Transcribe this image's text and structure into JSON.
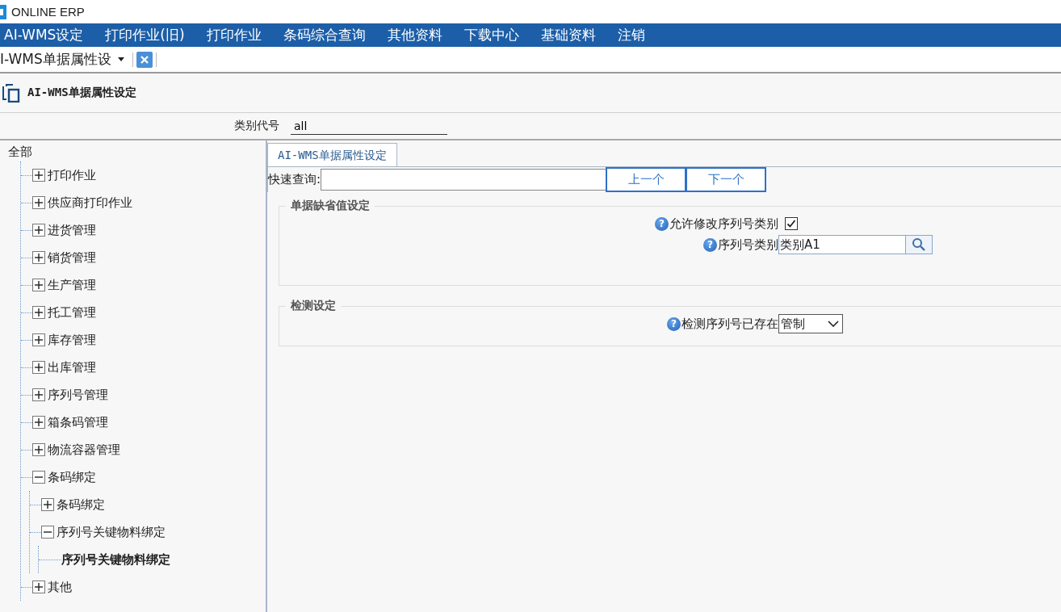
{
  "window": {
    "title": "ONLINE ERP"
  },
  "menu": [
    {
      "label": "AI-WMS设定"
    },
    {
      "label": "打印作业(旧)"
    },
    {
      "label": "打印作业"
    },
    {
      "label": "条码综合查询"
    },
    {
      "label": "其他资料"
    },
    {
      "label": "下载中心"
    },
    {
      "label": "基础资料"
    },
    {
      "label": "注销"
    }
  ],
  "doc_tabs": [
    {
      "label": "I-WMS单据属性设",
      "selected": true
    }
  ],
  "page": {
    "title": "AI-WMS单据属性设定"
  },
  "filter": {
    "label": "类别代号",
    "value": "all"
  },
  "tree": {
    "label": "全部",
    "children": [
      {
        "label": "打印作业",
        "expanded": false
      },
      {
        "label": "供应商打印作业",
        "expanded": false
      },
      {
        "label": "进货管理",
        "expanded": false
      },
      {
        "label": "销货管理",
        "expanded": false
      },
      {
        "label": "生产管理",
        "expanded": false
      },
      {
        "label": "托工管理",
        "expanded": false
      },
      {
        "label": "库存管理",
        "expanded": false
      },
      {
        "label": "出库管理",
        "expanded": false
      },
      {
        "label": "序列号管理",
        "expanded": false
      },
      {
        "label": "箱条码管理",
        "expanded": false
      },
      {
        "label": "物流容器管理",
        "expanded": false
      },
      {
        "label": "条码绑定",
        "expanded": true,
        "children": [
          {
            "label": "条码绑定",
            "expanded": false
          },
          {
            "label": "序列号关键物料绑定",
            "expanded": true,
            "children": [
              {
                "label": "序列号关键物料绑定",
                "selected": true
              }
            ]
          }
        ]
      },
      {
        "label": "其他",
        "expanded": false
      }
    ]
  },
  "panel_tabs": [
    {
      "label": "AI-WMS单据属性设定",
      "selected": true
    }
  ],
  "quick_search": {
    "label": "快速查询:",
    "buttons": [
      "上一个",
      "下一个"
    ]
  },
  "sections": [
    {
      "legend": "单据缺省值设定",
      "fields": [
        {
          "kind": "checkbox",
          "help": "?",
          "label": "允许修改序列号类别",
          "checked": true
        },
        {
          "kind": "lookup",
          "help": "?",
          "label": "序列号类别",
          "value": "类别A1"
        }
      ]
    },
    {
      "legend": "检测设定",
      "fields": [
        {
          "kind": "select",
          "help": "?",
          "label": "检测序列号已存在",
          "value": "管制"
        }
      ]
    }
  ]
}
